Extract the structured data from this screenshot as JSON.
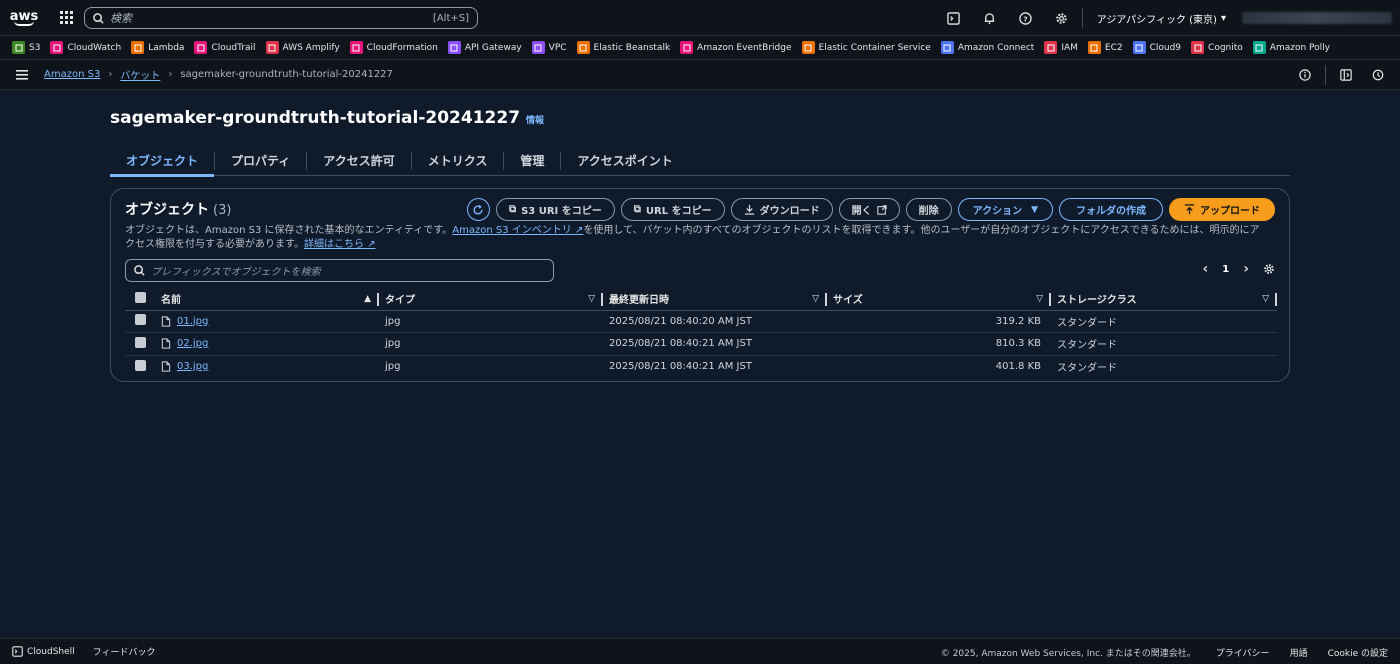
{
  "topnav": {
    "logo_text": "aws",
    "search_placeholder": "検索",
    "search_shortcut": "[Alt+S]",
    "region": "アジアパシフィック (東京)"
  },
  "favorites": [
    {
      "label": "S3",
      "color": "#3f8624"
    },
    {
      "label": "CloudWatch",
      "color": "#e7157b"
    },
    {
      "label": "Lambda",
      "color": "#ed7100"
    },
    {
      "label": "CloudTrail",
      "color": "#e7157b"
    },
    {
      "label": "AWS Amplify",
      "color": "#dd344c"
    },
    {
      "label": "CloudFormation",
      "color": "#e7157b"
    },
    {
      "label": "API Gateway",
      "color": "#8c4fff"
    },
    {
      "label": "VPC",
      "color": "#8c4fff"
    },
    {
      "label": "Elastic Beanstalk",
      "color": "#ed7100"
    },
    {
      "label": "Amazon EventBridge",
      "color": "#e7157b"
    },
    {
      "label": "Elastic Container Service",
      "color": "#ed7100"
    },
    {
      "label": "Amazon Connect",
      "color": "#4d72f3"
    },
    {
      "label": "IAM",
      "color": "#dd344c"
    },
    {
      "label": "EC2",
      "color": "#ed7100"
    },
    {
      "label": "Cloud9",
      "color": "#4d72f3"
    },
    {
      "label": "Cognito",
      "color": "#dd344c"
    },
    {
      "label": "Amazon Polly",
      "color": "#01a88d"
    }
  ],
  "breadcrumb": {
    "root": "Amazon S3",
    "buckets": "バケット",
    "current": "sagemaker-groundtruth-tutorial-20241227"
  },
  "page": {
    "title": "sagemaker-groundtruth-tutorial-20241227",
    "info": "情報"
  },
  "tabs": [
    "オブジェクト",
    "プロパティ",
    "アクセス許可",
    "メトリクス",
    "管理",
    "アクセスポイント"
  ],
  "objects_panel": {
    "title": "オブジェクト",
    "count": "(3)",
    "buttons": {
      "copy_s3_uri": "S3 URI をコピー",
      "copy_url": "URL をコピー",
      "download": "ダウンロード",
      "open": "開く",
      "delete": "削除",
      "actions": "アクション",
      "create_folder": "フォルダの作成",
      "upload": "アップロード"
    },
    "description_1": "オブジェクトは、Amazon S3 に保存された基本的なエンティティです。",
    "inventory_link": "Amazon S3 インベントリ",
    "description_2": "を使用して、バケット内のすべてのオブジェクトのリストを取得できます。他のユーザーが自分のオブジェクトにアクセスできるためには、明示的にア",
    "description_3": "クセス権限を付与する必要があります。",
    "learn_more": "詳細はこちら",
    "filter_placeholder": "プレフィックスでオブジェクトを検索",
    "page_number": "1"
  },
  "table": {
    "columns": [
      "名前",
      "タイプ",
      "最終更新日時",
      "サイズ",
      "ストレージクラス"
    ],
    "rows": [
      {
        "name": "01.jpg",
        "type": "jpg",
        "modified": "2025/08/21 08:40:20 AM JST",
        "size": "319.2 KB",
        "storage": "スタンダード"
      },
      {
        "name": "02.jpg",
        "type": "jpg",
        "modified": "2025/08/21 08:40:21 AM JST",
        "size": "810.3 KB",
        "storage": "スタンダード"
      },
      {
        "name": "03.jpg",
        "type": "jpg",
        "modified": "2025/08/21 08:40:21 AM JST",
        "size": "401.8 KB",
        "storage": "スタンダード"
      }
    ]
  },
  "footer": {
    "cloudshell": "CloudShell",
    "feedback": "フィードバック",
    "copyright": "© 2025, Amazon Web Services, Inc. またはその関連会社。",
    "privacy": "プライバシー",
    "terms": "用語",
    "cookie": "Cookie の設定"
  }
}
